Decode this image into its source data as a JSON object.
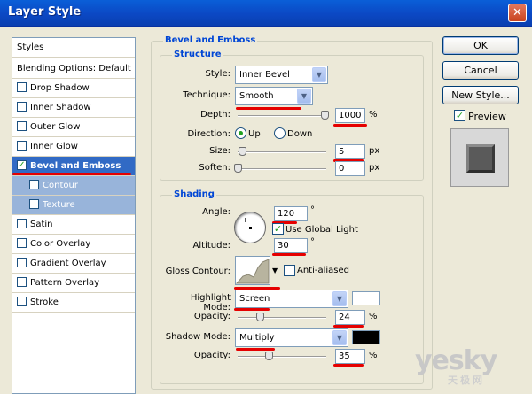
{
  "window": {
    "title": "Layer Style",
    "close_glyph": "✕"
  },
  "styles_panel": {
    "header": "Styles",
    "blending": "Blending Options: Default",
    "items": [
      {
        "label": "Drop Shadow",
        "checked": false
      },
      {
        "label": "Inner Shadow",
        "checked": false
      },
      {
        "label": "Outer Glow",
        "checked": false
      },
      {
        "label": "Inner Glow",
        "checked": false
      },
      {
        "label": "Bevel and Emboss",
        "checked": true
      },
      {
        "label": "Contour",
        "checked": false
      },
      {
        "label": "Texture",
        "checked": false
      },
      {
        "label": "Satin",
        "checked": false
      },
      {
        "label": "Color Overlay",
        "checked": false
      },
      {
        "label": "Gradient Overlay",
        "checked": false
      },
      {
        "label": "Pattern Overlay",
        "checked": false
      },
      {
        "label": "Stroke",
        "checked": false
      }
    ]
  },
  "bevel": {
    "title": "Bevel and Emboss",
    "structure": {
      "title": "Structure",
      "style_label": "Style:",
      "style_value": "Inner Bevel",
      "technique_label": "Technique:",
      "technique_value": "Smooth",
      "depth_label": "Depth:",
      "depth_value": "1000",
      "depth_unit": "%",
      "direction_label": "Direction:",
      "dir_up": "Up",
      "dir_down": "Down",
      "size_label": "Size:",
      "size_value": "5",
      "size_unit": "px",
      "soften_label": "Soften:",
      "soften_value": "0",
      "soften_unit": "px"
    },
    "shading": {
      "title": "Shading",
      "angle_label": "Angle:",
      "angle_value": "120",
      "angle_unit": "°",
      "global_light": "Use Global Light",
      "altitude_label": "Altitude:",
      "altitude_value": "30",
      "altitude_unit": "°",
      "gloss_label": "Gloss Contour:",
      "anti_aliased": "Anti-aliased",
      "highlight_label": "Highlight Mode:",
      "highlight_value": "Screen",
      "highlight_opacity_label": "Opacity:",
      "highlight_opacity_value": "24",
      "highlight_opacity_unit": "%",
      "shadow_label": "Shadow Mode:",
      "shadow_value": "Multiply",
      "shadow_opacity_label": "Opacity:",
      "shadow_opacity_value": "35",
      "shadow_opacity_unit": "%",
      "highlight_color": "#ffffff",
      "shadow_color": "#000000"
    }
  },
  "buttons": {
    "ok": "OK",
    "cancel": "Cancel",
    "new_style": "New Style...",
    "preview": "Preview"
  },
  "watermark": {
    "main": "yesky",
    "sub": "天极网"
  }
}
